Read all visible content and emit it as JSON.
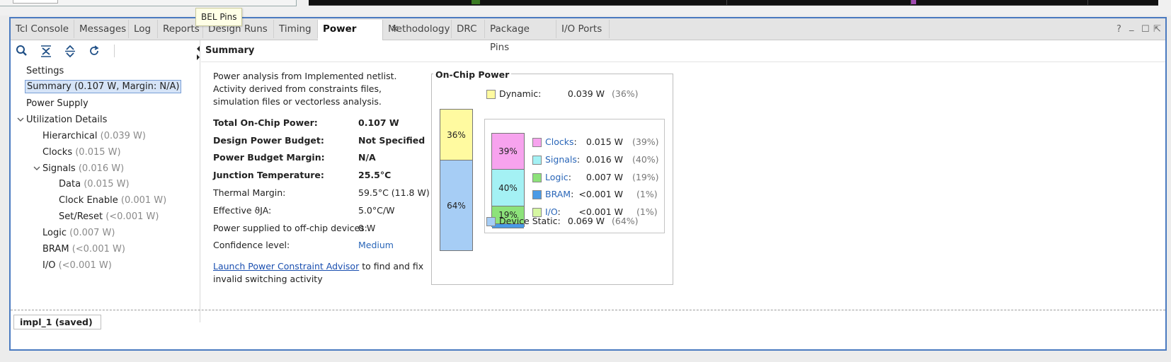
{
  "tooltip": "BEL Pins",
  "tabs": [
    "Tcl Console",
    "Messages",
    "Log",
    "Reports",
    "Design Runs",
    "Timing",
    "Power",
    "Methodology",
    "DRC",
    "Package Pins",
    "I/O Ports"
  ],
  "active_tab": "Power",
  "close_glyph": "×",
  "window_controls": {
    "help": "?",
    "minimize": "_",
    "restore": "☐",
    "float": "⇱"
  },
  "toolbar_icons": [
    "search-icon",
    "collapse-all-icon",
    "expand-all-icon",
    "refresh-icon"
  ],
  "tree": {
    "settings": "Settings",
    "summary": "Summary (0.107 W, Margin: N/A)",
    "power_supply": "Power Supply",
    "utilization_details": "Utilization Details",
    "hierarchical": {
      "label": "Hierarchical",
      "value": "(0.039 W)"
    },
    "clocks": {
      "label": "Clocks",
      "value": "(0.015 W)"
    },
    "signals": {
      "label": "Signals",
      "value": "(0.016 W)"
    },
    "data": {
      "label": "Data",
      "value": "(0.015 W)"
    },
    "clock_enable": {
      "label": "Clock Enable",
      "value": "(0.001 W)"
    },
    "set_reset": {
      "label": "Set/Reset",
      "value": "(<0.001 W)"
    },
    "logic": {
      "label": "Logic",
      "value": "(0.007 W)"
    },
    "bram": {
      "label": "BRAM",
      "value": "(<0.001 W)"
    },
    "io": {
      "label": "I/O",
      "value": "(<0.001 W)"
    }
  },
  "summary": {
    "title": "Summary",
    "description": "Power analysis from Implemented netlist. Activity derived from constraints files, simulation files or vectorless analysis.",
    "rows": [
      {
        "label": "Total On-Chip Power:",
        "value": "0.107 W"
      },
      {
        "label": "Design Power Budget:",
        "value": "Not Specified"
      },
      {
        "label": "Power Budget Margin:",
        "value": "N/A"
      },
      {
        "label": "Junction Temperature:",
        "value": "25.5°C"
      },
      {
        "label": "Thermal Margin:",
        "value": "59.5°C (11.8 W)"
      },
      {
        "label": "Effective ϑJA:",
        "value": "5.0°C/W"
      },
      {
        "label": "Power supplied to off-chip devices:",
        "value": "0 W"
      },
      {
        "label": "Confidence level:",
        "value": "Medium"
      }
    ],
    "advisor_link": "Launch Power Constraint Advisor",
    "advisor_text": " to find and fix invalid switching activity"
  },
  "on_chip_power": {
    "title": "On-Chip Power",
    "dynamic": {
      "label": "Dynamic:",
      "value": "0.039 W",
      "pct": "(36%)",
      "bar_label": "36%",
      "fraction": 0.36,
      "color": "#fffaa0"
    },
    "static": {
      "label": "Device Static:",
      "value": "0.069 W",
      "pct": "(64%)",
      "bar_label": "64%",
      "fraction": 0.64,
      "color": "#a6cdf5"
    },
    "breakdown": [
      {
        "label": "Clocks",
        "value": "0.015 W",
        "pct": "(39%)",
        "bar_label": "39%",
        "fraction": 0.39,
        "color": "#f7a3ee"
      },
      {
        "label": "Signals",
        "value": "0.016 W",
        "pct": "(40%)",
        "bar_label": "40%",
        "fraction": 0.4,
        "color": "#a4f1f4"
      },
      {
        "label": "Logic",
        "value": "0.007 W",
        "pct": "(19%)",
        "bar_label": "19%",
        "fraction": 0.19,
        "color": "#8de27a"
      },
      {
        "label": "BRAM",
        "value": "<0.001 W",
        "pct": "(1%)",
        "bar_label": "",
        "fraction": 0.01,
        "color": "#4a9ae6"
      },
      {
        "label": "I/O",
        "value": "<0.001 W",
        "pct": "(1%)",
        "bar_label": "",
        "fraction": 0.01,
        "color": "#d6f7a2"
      }
    ],
    "legend_colon": ":"
  },
  "status_tab": "impl_1 (saved)"
}
